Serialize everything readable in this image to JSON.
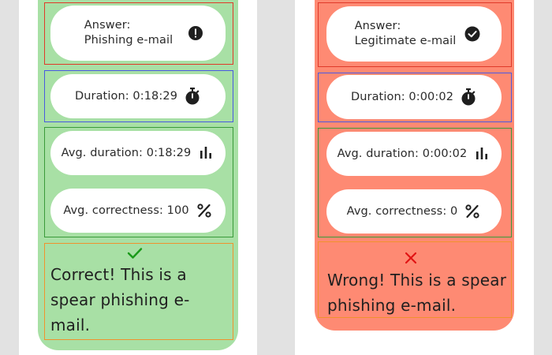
{
  "colors": {
    "background": "#e2e2e2",
    "panel": "#ffffff",
    "correct_card": "#a8e0a5",
    "wrong_card": "#fe8a73",
    "correct_check": "#1a9a1a",
    "wrong_cross": "#e11414"
  },
  "left": {
    "answer_prefix": "Answer:",
    "answer_value": "Phishing e-mail",
    "answer_icon": "alert-circle-icon",
    "duration": "Duration: 0:18:29",
    "duration_icon": "stopwatch-icon",
    "avg_duration": "Avg. duration: 0:18:29",
    "avg_duration_icon": "bar-chart-icon",
    "avg_correctness": "Avg. correctness: 100",
    "avg_correctness_icon": "percent-icon",
    "verdict_icon": "checkmark-icon",
    "verdict_text": "Correct! This is a spear phishing e-mail."
  },
  "right": {
    "answer_prefix": "Answer:",
    "answer_value": "Legitimate e-mail",
    "answer_icon": "check-circle-icon",
    "duration": "Duration: 0:00:02",
    "duration_icon": "stopwatch-icon",
    "avg_duration": "Avg. duration: 0:00:02",
    "avg_duration_icon": "bar-chart-icon",
    "avg_correctness": "Avg. correctness: 0",
    "avg_correctness_icon": "percent-icon",
    "verdict_icon": "cross-icon",
    "verdict_text": "Wrong! This is a spear phishing e-mail."
  }
}
